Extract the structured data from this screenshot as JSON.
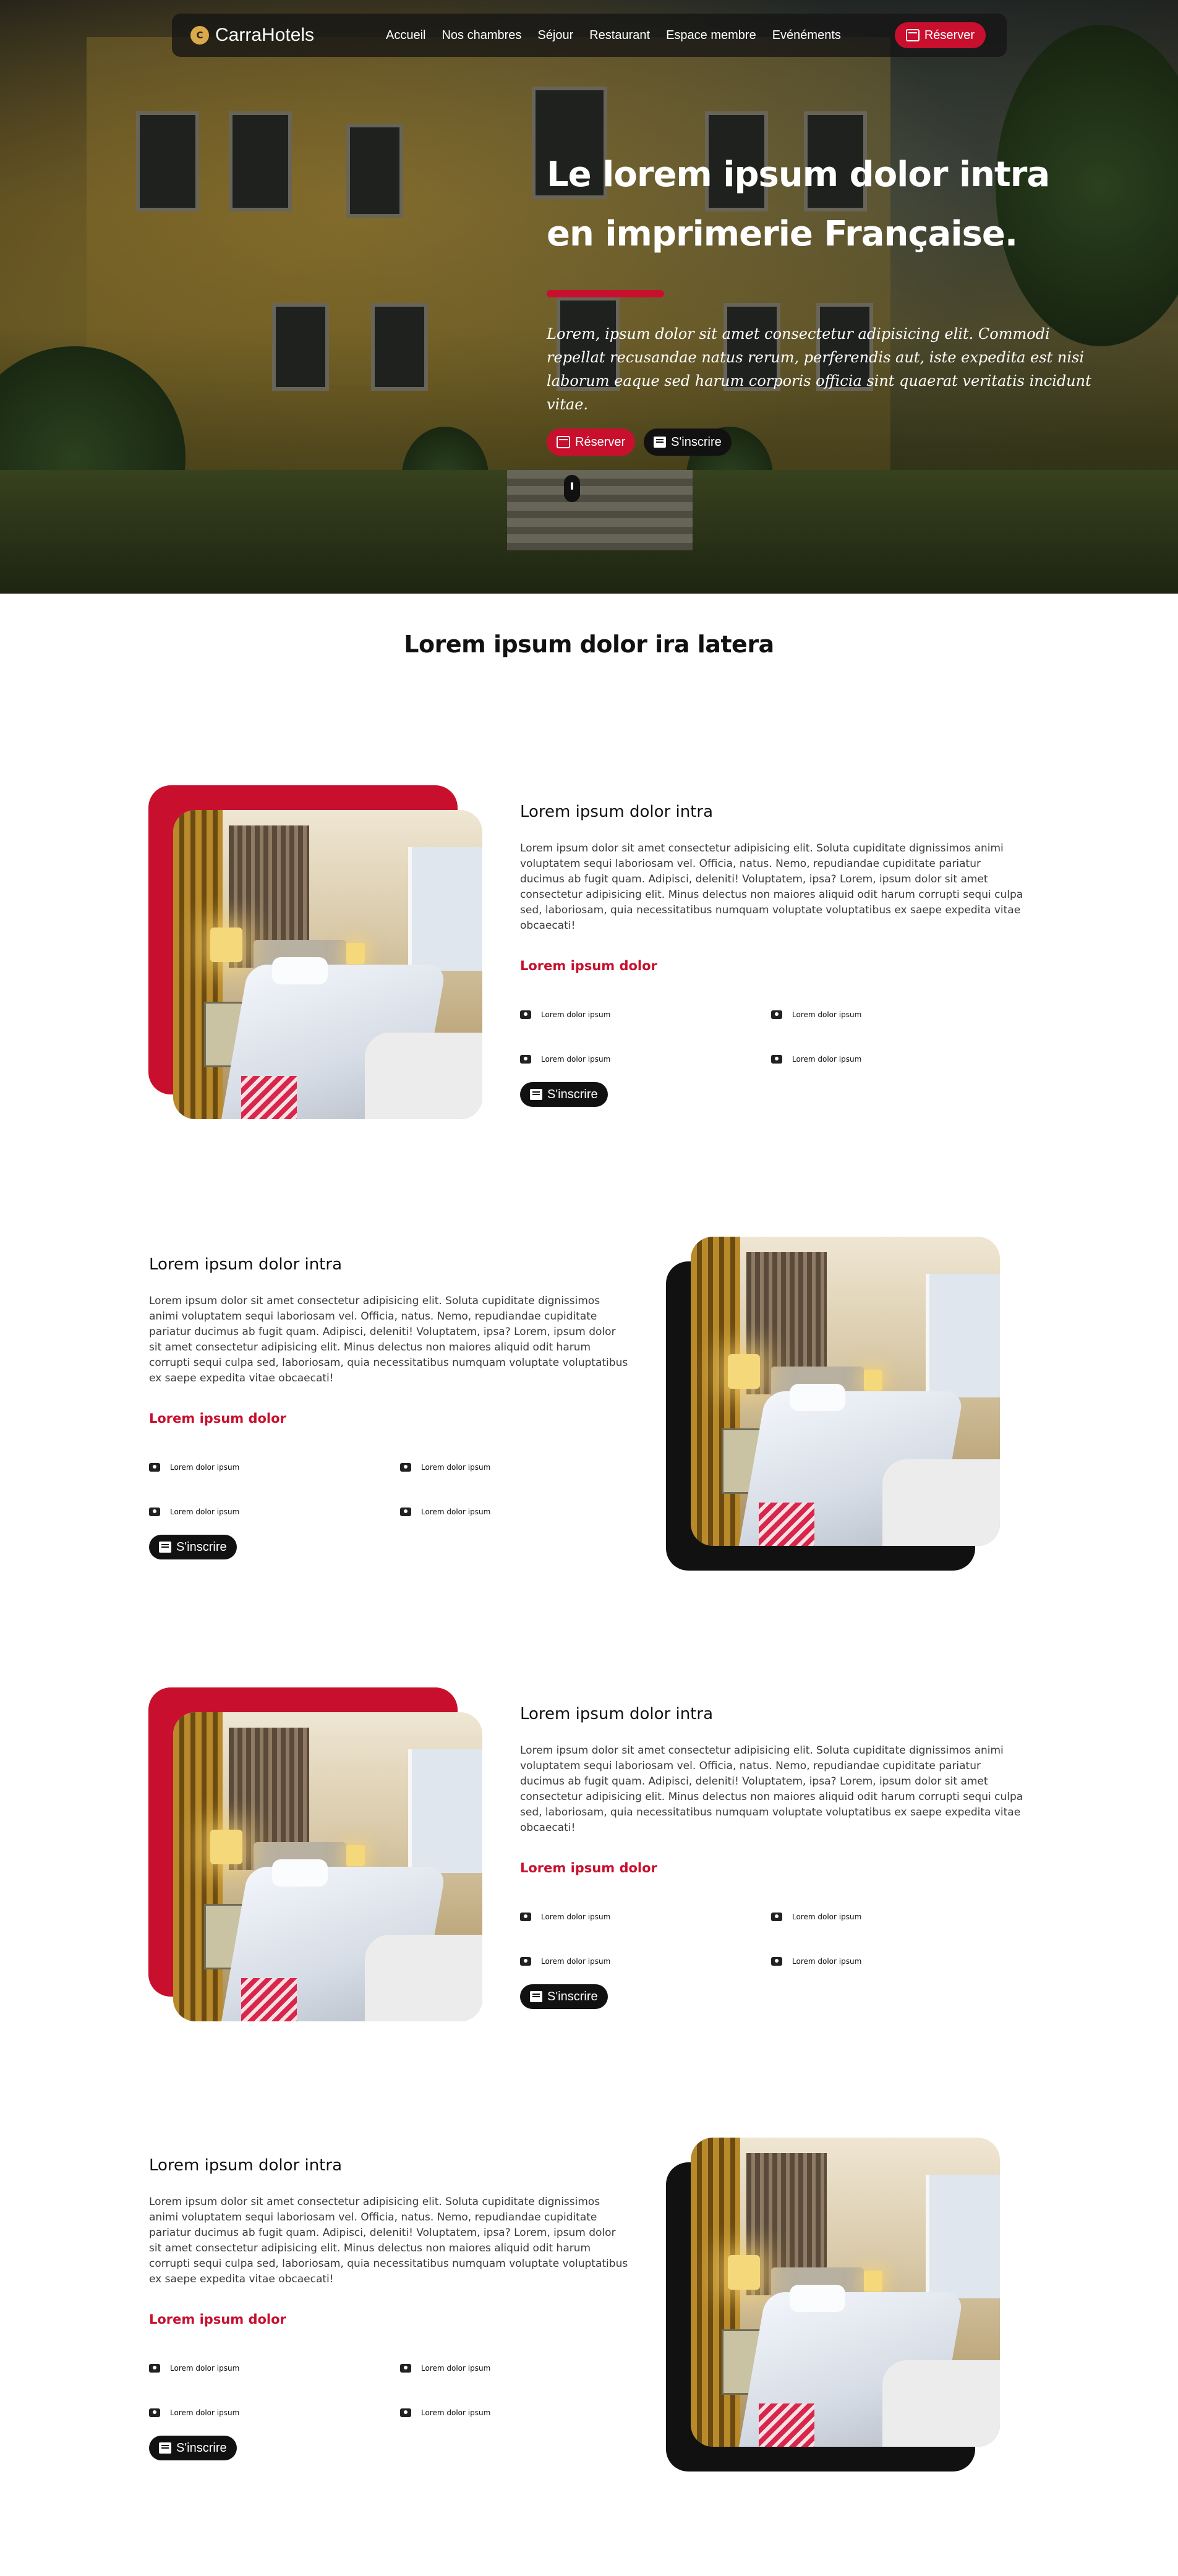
{
  "nav": {
    "brand": "CarraHotels",
    "menu": [
      "Accueil",
      "Nos chambres",
      "Séjour",
      "Restaurant",
      "Espace membre",
      "Evénéments"
    ],
    "cta": "Réserver"
  },
  "hero": {
    "title_line1": "Le lorem ipsum dolor intra",
    "title_line2": "en imprimerie Française.",
    "description": "Lorem, ipsum dolor sit amet consectetur adipisicing elit. Commodi repellat recusandae natus rerum, perferendis aut, iste expedita est nisi laborum eaque sed harum corporis officia sint quaerat veritatis incidunt vitae.",
    "btn_book": "Réserver",
    "btn_register": "S'inscrire"
  },
  "section_title": "Lorem ipsum dolor ira latera",
  "features": [
    {
      "title": "Lorem ipsum dolor intra",
      "body": "Lorem ipsum dolor sit amet consectetur adipisicing elit. Soluta cupiditate dignissimos animi voluptatem sequi laboriosam vel. Officia, natus. Nemo, repudiandae cupiditate pariatur ducimus ab fugit quam. Adipisci, deleniti! Voluptatem, ipsa? Lorem, ipsum dolor sit amet consectetur adipisicing elit. Minus delectus non maiores aliquid odit harum corrupti sequi culpa sed, laboriosam, quia necessitatibus numquam voluptate voluptatibus ex saepe expedita vitae obcaecati!",
      "subtitle": "Lorem ipsum dolor",
      "amenities": [
        "Lorem dolor ipsum",
        "Lorem dolor ipsum",
        "Lorem dolor ipsum",
        "Lorem dolor ipsum"
      ],
      "button": "S'inscrire"
    },
    {
      "title": "Lorem ipsum dolor intra",
      "body": "Lorem ipsum dolor sit amet consectetur adipisicing elit. Soluta cupiditate dignissimos animi voluptatem sequi laboriosam vel. Officia, natus. Nemo, repudiandae cupiditate pariatur ducimus ab fugit quam. Adipisci, deleniti! Voluptatem, ipsa? Lorem, ipsum dolor sit amet consectetur adipisicing elit. Minus delectus non maiores aliquid odit harum corrupti sequi culpa sed, laboriosam, quia necessitatibus numquam voluptate voluptatibus ex saepe expedita vitae obcaecati!",
      "subtitle": "Lorem ipsum dolor",
      "amenities": [
        "Lorem dolor ipsum",
        "Lorem dolor ipsum",
        "Lorem dolor ipsum",
        "Lorem dolor ipsum"
      ],
      "button": "S'inscrire"
    },
    {
      "title": "Lorem ipsum dolor intra",
      "body": "Lorem ipsum dolor sit amet consectetur adipisicing elit. Soluta cupiditate dignissimos animi voluptatem sequi laboriosam vel. Officia, natus. Nemo, repudiandae cupiditate pariatur ducimus ab fugit quam. Adipisci, deleniti! Voluptatem, ipsa? Lorem, ipsum dolor sit amet consectetur adipisicing elit. Minus delectus non maiores aliquid odit harum corrupti sequi culpa sed, laboriosam, quia necessitatibus numquam voluptate voluptatibus ex saepe expedita vitae obcaecati!",
      "subtitle": "Lorem ipsum dolor",
      "amenities": [
        "Lorem dolor ipsum",
        "Lorem dolor ipsum",
        "Lorem dolor ipsum",
        "Lorem dolor ipsum"
      ],
      "button": "S'inscrire"
    },
    {
      "title": "Lorem ipsum dolor intra",
      "body": "Lorem ipsum dolor sit amet consectetur adipisicing elit. Soluta cupiditate dignissimos animi voluptatem sequi laboriosam vel. Officia, natus. Nemo, repudiandae cupiditate pariatur ducimus ab fugit quam. Adipisci, deleniti! Voluptatem, ipsa? Lorem, ipsum dolor sit amet consectetur adipisicing elit. Minus delectus non maiores aliquid odit harum corrupti sequi culpa sed, laboriosam, quia necessitatibus numquam voluptate voluptatibus ex saepe expedita vitae obcaecati!",
      "subtitle": "Lorem ipsum dolor",
      "amenities": [
        "Lorem dolor ipsum",
        "Lorem dolor ipsum",
        "Lorem dolor ipsum",
        "Lorem dolor ipsum"
      ],
      "button": "S'inscrire"
    }
  ],
  "colors": {
    "accent": "#c8102e",
    "dark": "#111111",
    "nav_bg": "#141414"
  },
  "icons": {
    "logo": "hotel-logo-icon",
    "reserve": "calendar-icon",
    "register": "book-icon",
    "amenity": "camera-icon",
    "scroll": "mouse-scroll-icon"
  }
}
